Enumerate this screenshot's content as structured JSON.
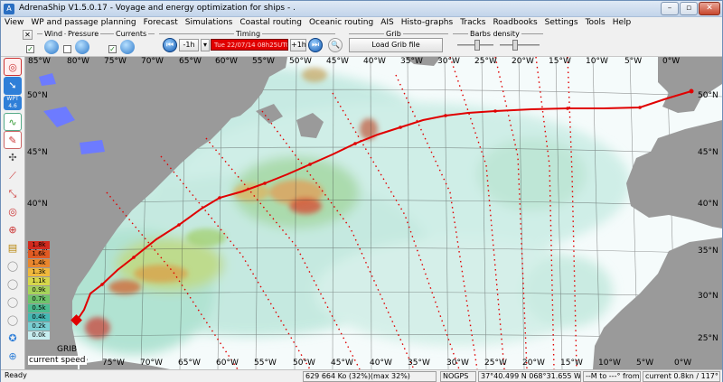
{
  "window": {
    "title": "AdrenaShip V1.5.0.17 - Voyage and energy optimization for ships - ."
  },
  "menu": [
    "View",
    "WP and passage planning",
    "Forecast",
    "Simulations",
    "Coastal routing",
    "Oceanic routing",
    "AIS",
    "Histo-graphs",
    "Tracks",
    "Roadbooks",
    "Settings",
    "Tools",
    "Help"
  ],
  "toolbar": {
    "close_x": "✕",
    "wind_label": "Wind",
    "pressure_label": "Pressure",
    "currents_label": "Currents",
    "timing_label": "Timing",
    "minus_label": "-1h",
    "plus_label": "+1h",
    "timing_value": "Tue 22/07/14 08h25UTC",
    "grib_label": "Grib",
    "load_grib": "Load Grib file",
    "barbs_label": "Barbs density"
  },
  "left_tools": {
    "wpt_label": "WPT",
    "wpt_distance": "4.6 nm"
  },
  "map": {
    "lon_labels": [
      "85°W",
      "80°W",
      "75°W",
      "70°W",
      "65°W",
      "60°W",
      "55°W",
      "50°W",
      "45°W",
      "40°W",
      "35°W",
      "30°W",
      "25°W",
      "20°W",
      "15°W",
      "10°W",
      "5°W",
      "0°W"
    ],
    "lat_labels": [
      "50°N",
      "45°N",
      "40°N",
      "35°N",
      "30°N",
      "25°N"
    ],
    "legend": [
      "1.8k",
      "1.6k",
      "1.4k",
      "1.3k",
      "1.1k",
      "0.9k",
      "0.7k",
      "0.5k",
      "0.4k",
      "0.2k",
      "0.0k"
    ],
    "legend_colors": [
      "#d22a1e",
      "#e05a22",
      "#e9862d",
      "#f0b83c",
      "#d6d64a",
      "#a7d35a",
      "#6fc46b",
      "#4bbd90",
      "#45b8b3",
      "#7ad0d4",
      "#c8eef0"
    ],
    "grib_label": "GRIB",
    "speed_label": "current speed",
    "route_color": "#e00000"
  },
  "status": {
    "ready": "Ready",
    "memory": "629 664 Ko (32%)(max 32%)",
    "gps": "NOGPS",
    "position": "37°40.499 N  068°31.655 W",
    "ship_info": "--M to ---° from ship",
    "current": "current 0.8kn / 117°"
  }
}
